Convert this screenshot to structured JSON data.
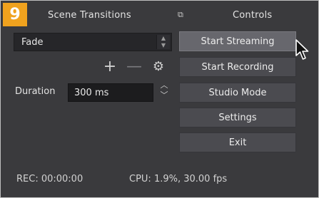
{
  "badge": "9",
  "transitions": {
    "title": "Scene Transitions",
    "selected": "Fade",
    "duration_label": "Duration",
    "duration_value": "300 ms"
  },
  "controls": {
    "title": "Controls",
    "buttons": [
      "Start Streaming",
      "Start Recording",
      "Studio Mode",
      "Settings",
      "Exit"
    ]
  },
  "status": {
    "rec": "REC: 00:00:00",
    "cpu": "CPU: 1.9%, 30.00 fps"
  },
  "icons": {
    "add": "plus-icon",
    "remove": "minus-icon",
    "properties": "gear-icon",
    "cursor": "mouse-pointer-icon"
  }
}
